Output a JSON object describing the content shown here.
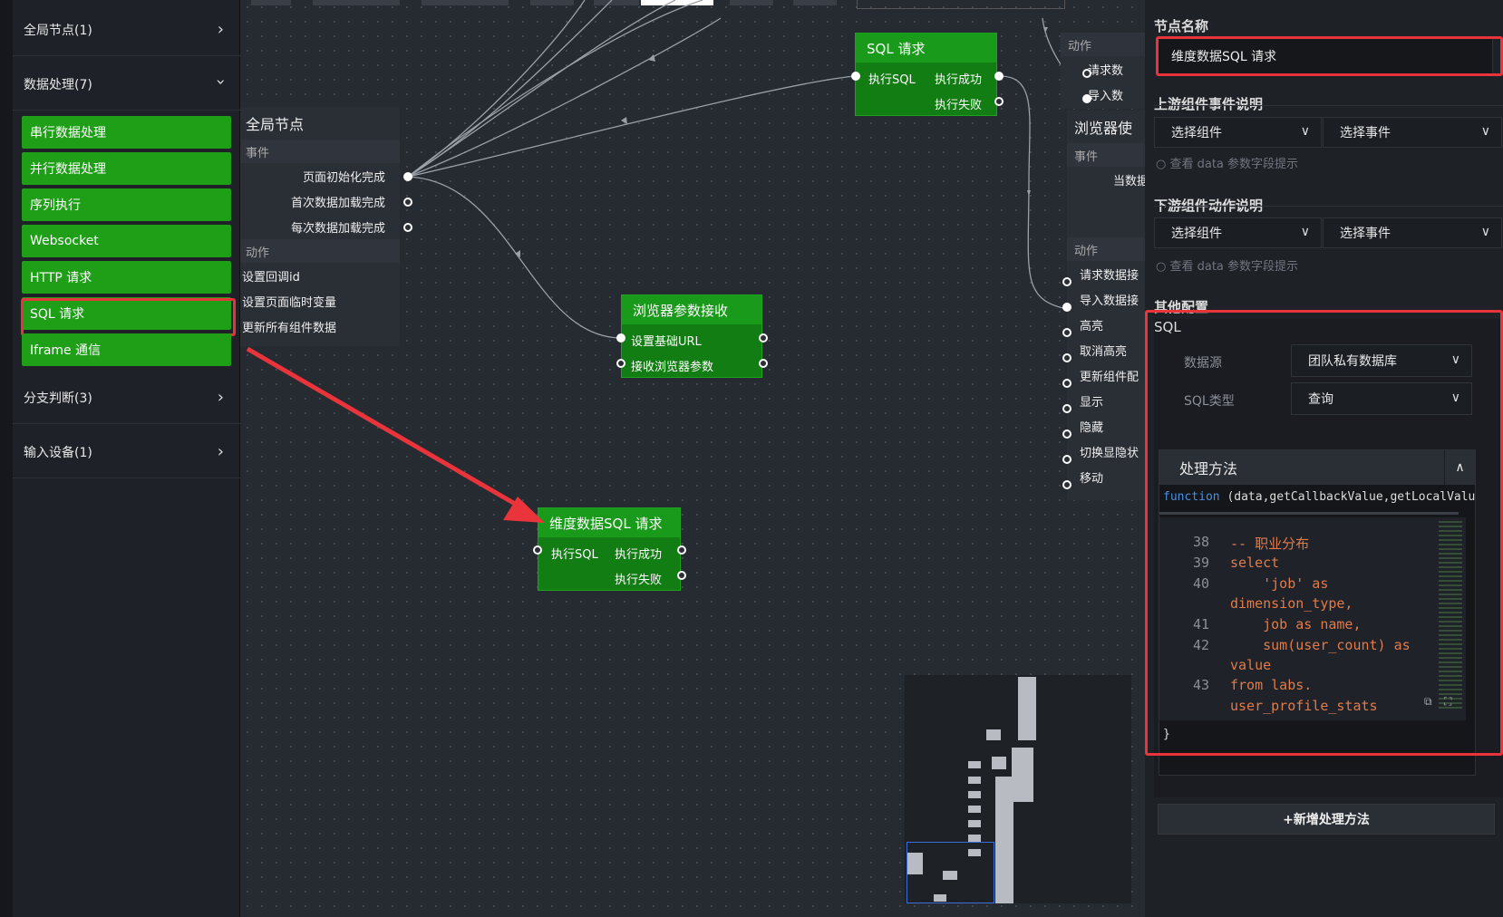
{
  "sidebar": {
    "categories": [
      {
        "label": "全局节点(1)"
      },
      {
        "label": "数据处理(7)"
      },
      {
        "label": "分支判断(3)"
      },
      {
        "label": "输入设备(1)"
      }
    ],
    "items": [
      {
        "label": "串行数据处理"
      },
      {
        "label": "并行数据处理"
      },
      {
        "label": "序列执行"
      },
      {
        "label": "Websocket"
      },
      {
        "label": "HTTP 请求"
      },
      {
        "label": "SQL 请求"
      },
      {
        "label": "Iframe 通信"
      }
    ]
  },
  "canvas": {
    "global_node": {
      "title": "全局节点",
      "events_label": "事件",
      "events": [
        "页面初始化完成",
        "首次数据加载完成",
        "每次数据加载完成"
      ],
      "actions_label": "动作",
      "actions": [
        "设置回调id",
        "设置页面临时变量",
        "更新所有组件数据"
      ]
    },
    "sql_node": {
      "title": "SQL 请求",
      "in": "执行SQL",
      "out1": "执行成功",
      "out2": "执行失败"
    },
    "browser_node": {
      "title": "浏览器参数接收",
      "row1": "设置基础URL",
      "row2": "接收浏览器参数"
    },
    "dim_node": {
      "title": "维度数据SQL 请求",
      "in": "执行SQL",
      "out1": "执行成功",
      "out2": "执行失败"
    },
    "top_right_node": {
      "actions_label": "动作",
      "actions": [
        "请求数",
        "导入数"
      ]
    },
    "browser_use_node": {
      "title": "浏览器使",
      "events_label": "事件",
      "events": [
        "当数据"
      ],
      "actions_label": "动作",
      "actions": [
        "请求数据接",
        "导入数据接",
        "高亮",
        "取消高亮",
        "更新组件配",
        "显示",
        "隐藏",
        "切换显隐状",
        "移动"
      ]
    }
  },
  "panel": {
    "node_name_title": "节点名称",
    "node_name_value": "维度数据SQL 请求",
    "upstream_title": "上游组件事件说明",
    "downstream_title": "下游组件动作说明",
    "select_component": "选择组件",
    "select_event": "选择事件",
    "hint": "查看 data 参数字段提示",
    "other_title": "其他配置",
    "sql_label": "SQL",
    "datasource_label": "数据源",
    "datasource_value": "团队私有数据库",
    "sqltype_label": "SQL类型",
    "sqltype_value": "查询",
    "method_title": "处理方法",
    "function_keyword": "function",
    "function_sig": "(data,getCallbackValue,getLocalValue",
    "code_lines": [
      {
        "n": "38",
        "t": "-- 职业分布"
      },
      {
        "n": "39",
        "t": "select"
      },
      {
        "n": "40",
        "t": "    'job' as"
      },
      {
        "n": "",
        "t": "dimension_type,"
      },
      {
        "n": "41",
        "t": "    job as name,"
      },
      {
        "n": "42",
        "t": "    sum(user_count) as"
      },
      {
        "n": "",
        "t": "value"
      },
      {
        "n": "43",
        "t": "from labs."
      },
      {
        "n": "",
        "t": "user_profile_stats"
      }
    ],
    "closing_brace": "}",
    "add_method": "+新增处理方法"
  },
  "colors": {
    "accent_green": "#1f9e17",
    "highlight_red": "#e8343a"
  }
}
